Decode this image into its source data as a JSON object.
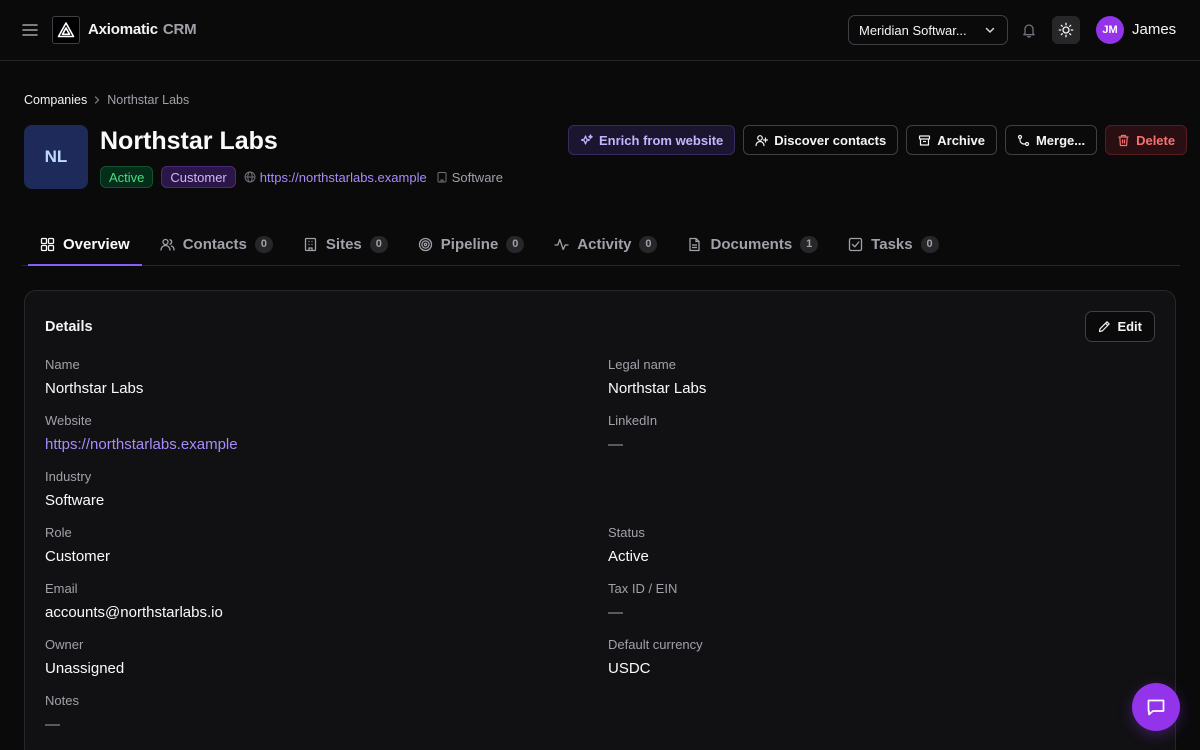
{
  "app": {
    "brand": "Axiomatic",
    "brand_sub": "CRM"
  },
  "header": {
    "workspace": "Meridian Softwar...",
    "user_initials": "JM",
    "user_name": "James"
  },
  "breadcrumb": {
    "parent": "Companies",
    "current": "Northstar Labs"
  },
  "company": {
    "initials": "NL",
    "name": "Northstar Labs",
    "status_badge": "Active",
    "role_badge": "Customer",
    "website": "https://northstarlabs.example",
    "industry": "Software"
  },
  "actions": {
    "enrich": "Enrich from website",
    "discover": "Discover contacts",
    "archive": "Archive",
    "merge": "Merge...",
    "delete": "Delete"
  },
  "tabs": [
    {
      "label": "Overview",
      "icon": "grid-icon"
    },
    {
      "label": "Contacts",
      "count": "0",
      "icon": "users-icon"
    },
    {
      "label": "Sites",
      "count": "0",
      "icon": "building-icon"
    },
    {
      "label": "Pipeline",
      "count": "0",
      "icon": "target-icon"
    },
    {
      "label": "Activity",
      "count": "0",
      "icon": "activity-icon"
    },
    {
      "label": "Documents",
      "count": "1",
      "icon": "file-icon"
    },
    {
      "label": "Tasks",
      "count": "0",
      "icon": "checkbox-icon"
    }
  ],
  "details": {
    "title": "Details",
    "edit_label": "Edit",
    "fields": {
      "name": {
        "label": "Name",
        "value": "Northstar Labs"
      },
      "legal_name": {
        "label": "Legal name",
        "value": "Northstar Labs"
      },
      "website": {
        "label": "Website",
        "value": "https://northstarlabs.example"
      },
      "linkedin": {
        "label": "LinkedIn",
        "value": "—"
      },
      "industry": {
        "label": "Industry",
        "value": "Software"
      },
      "role": {
        "label": "Role",
        "value": "Customer"
      },
      "status": {
        "label": "Status",
        "value": "Active"
      },
      "email": {
        "label": "Email",
        "value": "accounts@northstarlabs.io"
      },
      "tax_id": {
        "label": "Tax ID / EIN",
        "value": "—"
      },
      "owner": {
        "label": "Owner",
        "value": "Unassigned"
      },
      "currency": {
        "label": "Default currency",
        "value": "USDC"
      },
      "notes": {
        "label": "Notes",
        "value": "—"
      }
    }
  },
  "colors": {
    "accent": "#8b5cf6",
    "avatar": "#9333ea",
    "active_green": "#4ade80",
    "danger": "#f87171"
  }
}
